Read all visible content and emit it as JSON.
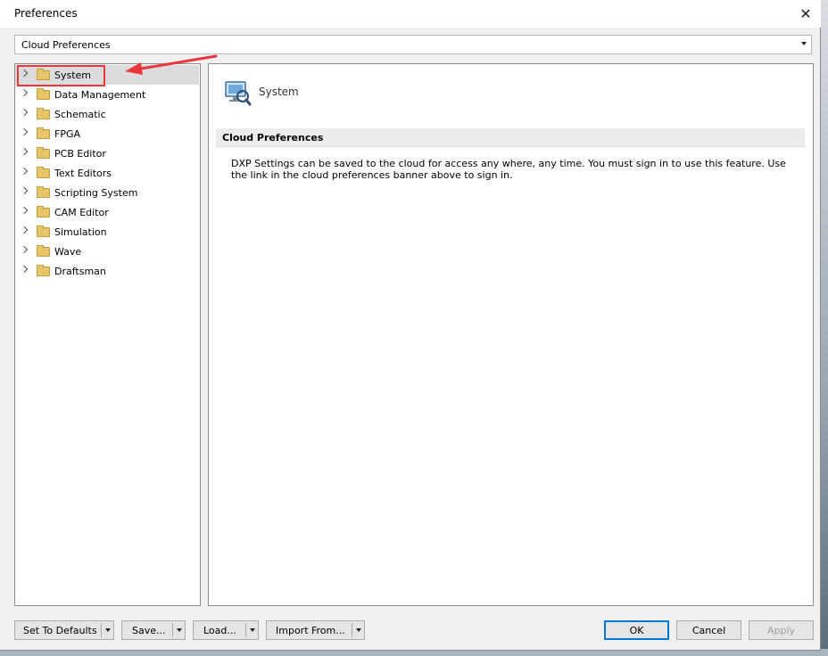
{
  "window": {
    "title": "Preferences",
    "close_glyph": "✕"
  },
  "category_combo": {
    "value": "Cloud Preferences"
  },
  "tree": {
    "items": [
      {
        "label": "System"
      },
      {
        "label": "Data Management"
      },
      {
        "label": "Schematic"
      },
      {
        "label": "FPGA"
      },
      {
        "label": "PCB Editor"
      },
      {
        "label": "Text Editors"
      },
      {
        "label": "Scripting System"
      },
      {
        "label": "CAM Editor"
      },
      {
        "label": "Simulation"
      },
      {
        "label": "Wave"
      },
      {
        "label": "Draftsman"
      }
    ],
    "selected_index": 0
  },
  "content": {
    "page_title": "System",
    "section_title": "Cloud Preferences",
    "description": "DXP Settings can be saved to the cloud for access any where, any time. You must sign in to use this feature. Use the link in the cloud preferences banner above to sign in."
  },
  "buttons": {
    "set_to_defaults": "Set To Defaults",
    "save": "Save...",
    "load": "Load...",
    "import_from": "Import From...",
    "ok": "OK",
    "cancel": "Cancel",
    "apply": "Apply"
  },
  "colors": {
    "highlight": "#e8383d",
    "ok_border": "#0078d7"
  }
}
